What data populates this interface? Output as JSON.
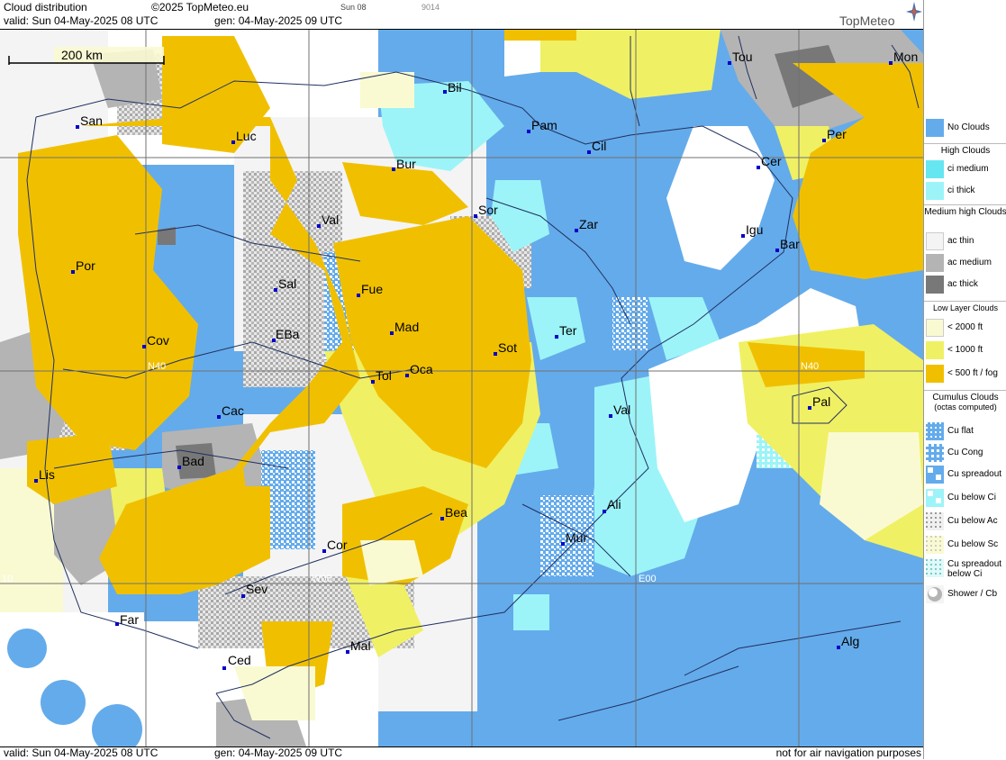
{
  "header": {
    "title": "Cloud distribution",
    "copyright": "©2025 TopMeteo.eu",
    "day_tag": "Sun 08",
    "code": "9014",
    "valid": "valid:  Sun  04-May-2025  08 UTC",
    "gen": "gen: 04-May-2025 09 UTC",
    "logo": "TopMeteo"
  },
  "footer": {
    "valid": "valid:  Sun  04-May-2025  08 UTC",
    "gen": "gen: 04-May-2025 09 UTC",
    "note": "not for air navigation purposes"
  },
  "map": {
    "scale_label": "200 km",
    "grid_labels": {
      "n40_left": "N40",
      "n40_right": "N40",
      "w05": "W05",
      "e00": "E00",
      "w10": "10"
    },
    "cities": {
      "bil": "Bil",
      "san": "San",
      "luc": "Luc",
      "bur": "Bur",
      "pam": "Pam",
      "cil": "Cil",
      "tou": "Tou",
      "mon": "Mon",
      "per": "Per",
      "cer": "Cer",
      "sor": "Sor",
      "zar": "Zar",
      "igu": "Igu",
      "bar": "Bar",
      "val_n": "Val",
      "por": "Por",
      "sal": "Sal",
      "fue": "Fue",
      "mad": "Mad",
      "cov": "Cov",
      "eba": "EBa",
      "sot": "Sot",
      "ter": "Ter",
      "tol": "Tol",
      "oca": "Oca",
      "val_e": "Val",
      "pal": "Pal",
      "cac": "Cac",
      "bad": "Bad",
      "lis": "Lis",
      "bea": "Bea",
      "ali": "Ali",
      "cor": "Cor",
      "mur": "Mur",
      "sev": "Sev",
      "far": "Far",
      "mal": "Mal",
      "alg": "Alg",
      "ced": "Ced"
    }
  },
  "legend": {
    "no_clouds": "No Clouds",
    "high_title": "High Clouds",
    "ci_medium": "ci medium",
    "ci_thick": "ci thick",
    "medium_title": "Medium high Clouds",
    "ac_thin": "ac thin",
    "ac_medium": "ac medium",
    "ac_thick": "ac thick",
    "low_title": "Low Layer Clouds",
    "low_2000": "< 2000 ft",
    "low_1000": "< 1000 ft",
    "low_500": "< 500 ft / fog",
    "cu_title": "Cumulus Clouds",
    "cu_sub": "(octas computed)",
    "cu_flat": "Cu flat",
    "cu_cong": "Cu Cong",
    "cu_spreadout": "Cu spreadout",
    "cu_below_ci": "Cu below Ci",
    "cu_below_ac": "Cu below Ac",
    "cu_below_sc": "Cu below Sc",
    "cu_spread_below_ci": "Cu spreadout below Ci",
    "shower": "Shower / Cb"
  },
  "colors": {
    "no_clouds": "#64abeb",
    "ci_medium": "#66e6f0",
    "ci_thick": "#9cf4f8",
    "ac_thin": "#f4f4f4",
    "ac_medium": "#b4b4b4",
    "ac_thick": "#787878",
    "low_2000": "#fafad2",
    "low_1000": "#f0f064",
    "low_500": "#f0c000"
  }
}
